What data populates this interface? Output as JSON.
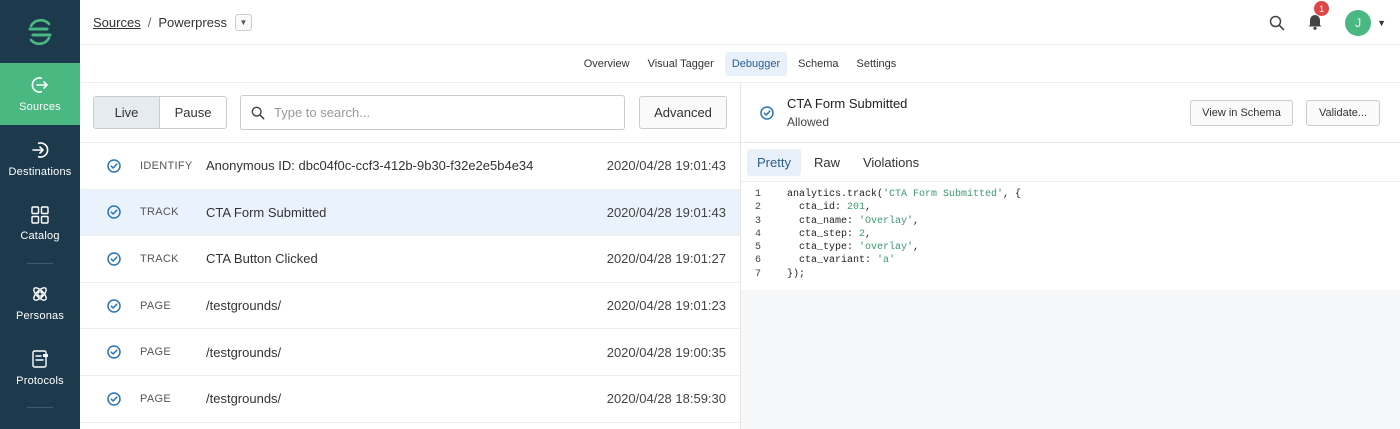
{
  "nav": {
    "items": [
      {
        "label": "Sources",
        "icon": "sources-icon",
        "active": true
      },
      {
        "label": "Destinations",
        "icon": "destinations-icon",
        "active": false
      },
      {
        "label": "Catalog",
        "icon": "catalog-icon",
        "active": false
      },
      {
        "label": "Personas",
        "icon": "personas-icon",
        "active": false
      },
      {
        "label": "Protocols",
        "icon": "protocols-icon",
        "active": false
      }
    ]
  },
  "header": {
    "breadcrumb_root": "Sources",
    "breadcrumb_sep": "/",
    "breadcrumb_current": "Powerpress",
    "notification_count": "1",
    "avatar_initial": "J"
  },
  "tabs": [
    "Overview",
    "Visual Tagger",
    "Debugger",
    "Schema",
    "Settings"
  ],
  "toolbar": {
    "live_label": "Live",
    "pause_label": "Pause",
    "search_placeholder": "Type to search...",
    "advanced_label": "Advanced"
  },
  "events": [
    {
      "type": "IDENTIFY",
      "name": "Anonymous ID: dbc04f0c-ccf3-412b-9b30-f32e2e5b4e34",
      "time": "2020/04/28 19:01:43"
    },
    {
      "type": "TRACK",
      "name": "CTA Form Submitted",
      "time": "2020/04/28 19:01:43"
    },
    {
      "type": "TRACK",
      "name": "CTA Button Clicked",
      "time": "2020/04/28 19:01:27"
    },
    {
      "type": "PAGE",
      "name": "/testgrounds/",
      "time": "2020/04/28 19:01:23"
    },
    {
      "type": "PAGE",
      "name": "/testgrounds/",
      "time": "2020/04/28 19:00:35"
    },
    {
      "type": "PAGE",
      "name": "/testgrounds/",
      "time": "2020/04/28 18:59:30"
    }
  ],
  "detail": {
    "title": "CTA Form Submitted",
    "status": "Allowed",
    "view_schema_label": "View in Schema",
    "validate_label": "Validate...",
    "code_tabs": [
      "Pretty",
      "Raw",
      "Violations"
    ],
    "code_lines": [
      "analytics.track('CTA Form Submitted', {",
      "  cta_id: 201,",
      "  cta_name: 'Overlay',",
      "  cta_step: 2,",
      "  cta_type: 'overlay',",
      "  cta_variant: 'a'",
      "});"
    ]
  },
  "colors": {
    "nav_bg": "#1d3a4d",
    "accent_green": "#49b881",
    "accent_blue": "#2b74b8",
    "badge_red": "#e04545"
  }
}
